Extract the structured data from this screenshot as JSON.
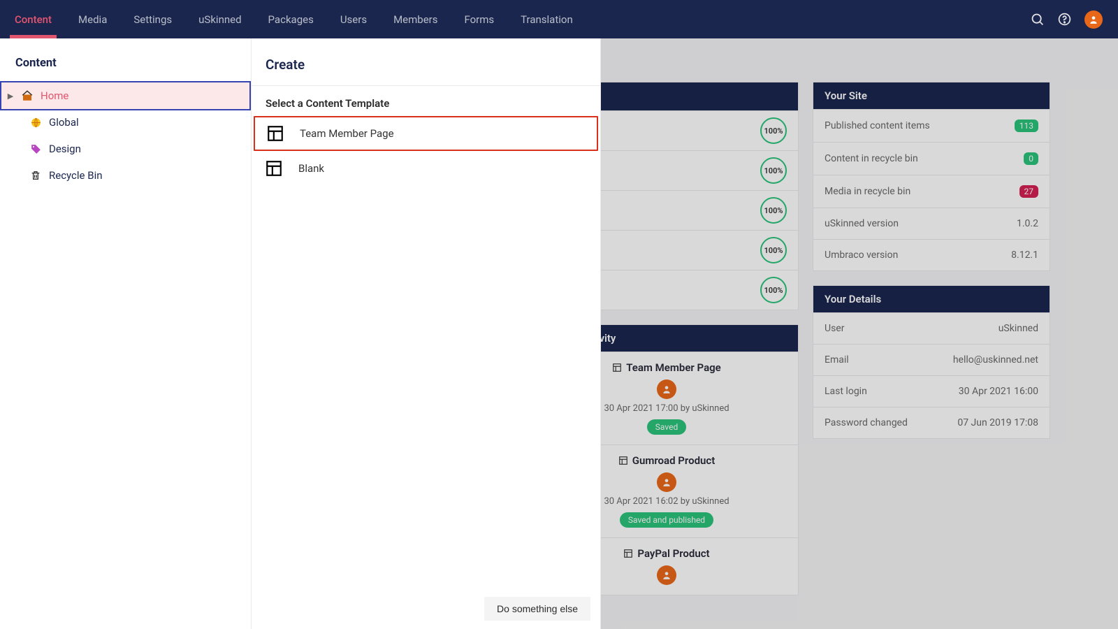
{
  "nav": [
    "Content",
    "Media",
    "Settings",
    "uSkinned",
    "Packages",
    "Users",
    "Members",
    "Forms",
    "Translation"
  ],
  "nav_active_index": 0,
  "tree": {
    "heading": "Content",
    "items": [
      {
        "label": "Home",
        "icon": "home",
        "selected": true,
        "has_children": true
      },
      {
        "label": "Global",
        "icon": "globe"
      },
      {
        "label": "Design",
        "icon": "tag"
      },
      {
        "label": "Recycle Bin",
        "icon": "trash"
      }
    ]
  },
  "create": {
    "title": "Create",
    "subheading": "Select a Content Template",
    "options": [
      {
        "label": "Team Member Page",
        "highlight": true
      },
      {
        "label": "Blank",
        "highlight": false
      }
    ],
    "footer_btn": "Do something else"
  },
  "progress_values": [
    "100%",
    "100%",
    "100%",
    "100%",
    "100%"
  ],
  "recent_activity": {
    "header": "Recent activity",
    "items": [
      {
        "title": "Team Member Page",
        "date": "30 Apr 2021 17:00 by uSkinned",
        "pill": "Saved",
        "pill_class": "saved"
      },
      {
        "title": "Gumroad Product",
        "date": "30 Apr 2021 16:02 by uSkinned",
        "pill": "Saved and published",
        "pill_class": "published"
      },
      {
        "title": "PayPal Product",
        "date": "",
        "pill": "",
        "pill_class": ""
      }
    ]
  },
  "site_card": {
    "header": "Your Site",
    "rows": [
      {
        "label": "Published content items",
        "value": "113",
        "badge_class": "green"
      },
      {
        "label": "Content in recycle bin",
        "value": "0",
        "badge_class": "green"
      },
      {
        "label": "Media in recycle bin",
        "value": "27",
        "badge_class": "red"
      },
      {
        "label": "uSkinned version",
        "value": "1.0.2"
      },
      {
        "label": "Umbraco version",
        "value": "8.12.1"
      }
    ]
  },
  "details_card": {
    "header": "Your Details",
    "rows": [
      {
        "label": "User",
        "value": "uSkinned"
      },
      {
        "label": "Email",
        "value": "hello@uskinned.net"
      },
      {
        "label": "Last login",
        "value": "30 Apr 2021 16:00"
      },
      {
        "label": "Password changed",
        "value": "07 Jun 2019 17:08"
      }
    ]
  }
}
